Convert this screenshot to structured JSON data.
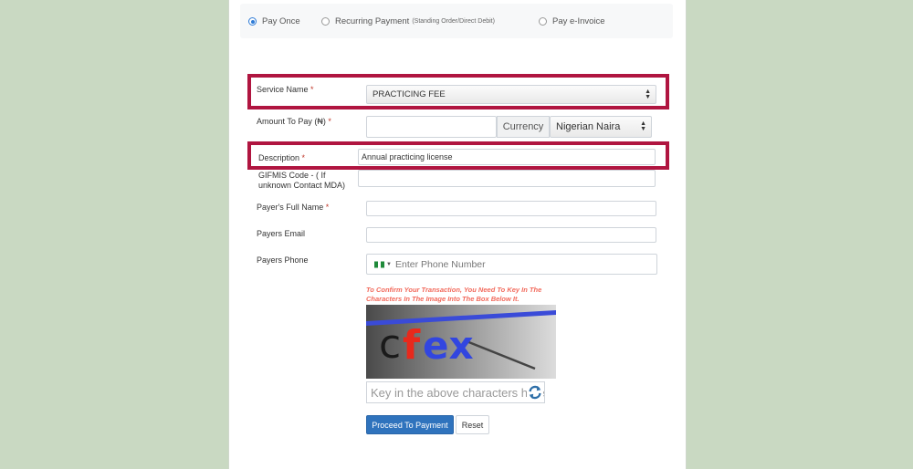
{
  "payment_options": [
    {
      "label": "Pay Once",
      "note": "",
      "checked": true
    },
    {
      "label": "Recurring Payment",
      "note": "(Standing Order/Direct Debit)",
      "checked": false
    },
    {
      "label": "Pay e-Invoice",
      "note": "",
      "checked": false
    }
  ],
  "form": {
    "service_name": {
      "label": "Service Name",
      "required": "*",
      "value": "PRACTICING FEE"
    },
    "amount": {
      "label": "Amount To Pay (₦)",
      "required": "*",
      "value": ""
    },
    "currency": {
      "label": "Currency",
      "value": "Nigerian Naira"
    },
    "description": {
      "label": "Description",
      "required": "*",
      "value": "Annual practicing license"
    },
    "gifmis": {
      "label": "GIFMIS Code - ( If unknown Contact MDA)",
      "value": ""
    },
    "full_name": {
      "label": "Payer's Full Name",
      "required": "*",
      "value": ""
    },
    "email": {
      "label": "Payers Email",
      "value": ""
    },
    "phone": {
      "label": "Payers Phone",
      "placeholder": "Enter Phone Number",
      "country": "Nigeria"
    }
  },
  "captcha": {
    "instructions": "To Confirm Your Transaction, You Need To Key In The Characters In The Image Into The Box Below It.",
    "image_text": {
      "c": "c",
      "f": "f",
      "rest": "ex"
    },
    "input_placeholder": "Key in the above characters here"
  },
  "buttons": {
    "proceed": "Proceed To Payment",
    "reset": "Reset"
  },
  "colors": {
    "highlight": "#b01540",
    "primary": "#2f73bd",
    "required": "#c0392b",
    "captcha_note": "#f26a5c",
    "background": "#c9d9c2"
  }
}
